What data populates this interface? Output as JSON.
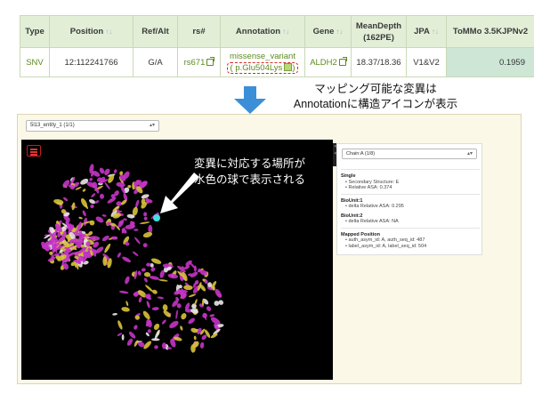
{
  "table": {
    "headers": [
      {
        "label": "Type",
        "sort": false
      },
      {
        "label": "Position",
        "sort": true
      },
      {
        "label": "Ref/Alt",
        "sort": false
      },
      {
        "label": "rs#",
        "sort": false
      },
      {
        "label": "Annotation",
        "sort": true
      },
      {
        "label": "Gene",
        "sort": true
      },
      {
        "label": "MeanDepth (162PE)",
        "line1": "MeanDepth",
        "line2": "(162PE)",
        "sort": false
      },
      {
        "label": "JPA",
        "sort": true
      },
      {
        "label": "ToMMo 3.5KJPNv2",
        "sort": false
      }
    ],
    "row": {
      "type": "SNV",
      "position": "12:112241766",
      "ref_alt": "G/A",
      "rs": "rs671",
      "annotation_line1": "missense_variant",
      "annotation_line2": "( p.Glu504Lys",
      "annotation_close": ")",
      "gene": "ALDH2",
      "mean_depth": "18.37/18.36",
      "jpa": "V1&V2",
      "tommo": "0.1959"
    },
    "sort_glyph": "↑↓"
  },
  "caption": {
    "line1": "マッピング可能な変異は",
    "line2": "Annotationに構造アイコンが表示"
  },
  "viewer": {
    "entity_select": "5l13_entity_1 (1/1)",
    "chain_select": "Chain:A (1/8)",
    "side_tab": "< <",
    "overlay_line1": "変異に対応する場所が",
    "overlay_line2": "水色の球で表示される",
    "info": {
      "single_title": "Single",
      "secondary_structure": "Secondary Structure: E",
      "relative_asa": "Relative ASA: 0.374",
      "bu1_title": "BioUnit:1",
      "bu1_delta": "delta Relative ASA: 0.295",
      "bu2_title": "BioUnit:2",
      "bu2_delta": "delta Relative ASA: NA",
      "mapped_title": "Mapped Position",
      "auth": "auth_asym_id: A, auth_seq_id: 487",
      "label": "label_asym_id: A, label_seq_id: 504"
    }
  },
  "colors": {
    "header_bg": "#e3eed7",
    "link_green": "#5c8a1e",
    "tommo_bg": "#cde6d5",
    "arrow_blue": "#3b8fd8",
    "highlight_red": "#d62b2b",
    "protein_magenta": "#c434c4",
    "protein_yellow": "#d9c23a",
    "mutation_cyan": "#3fe0e0"
  }
}
